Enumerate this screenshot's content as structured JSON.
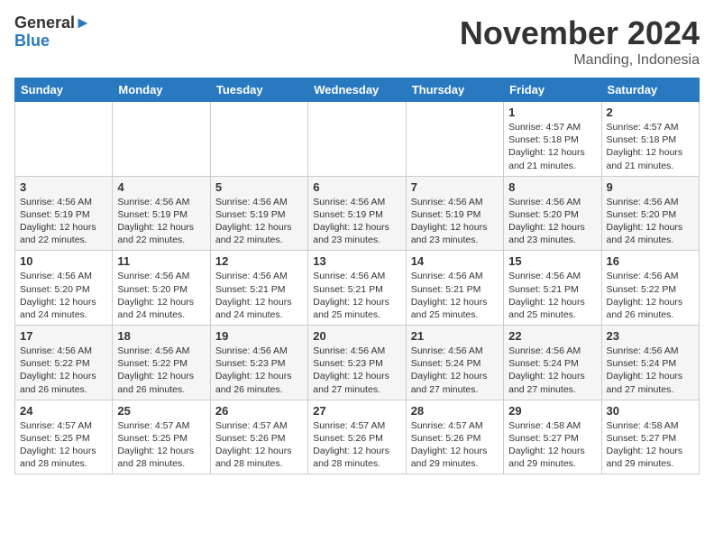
{
  "logo": {
    "general": "General",
    "blue": "Blue"
  },
  "title": "November 2024",
  "location": "Manding, Indonesia",
  "weekdays": [
    "Sunday",
    "Monday",
    "Tuesday",
    "Wednesday",
    "Thursday",
    "Friday",
    "Saturday"
  ],
  "weeks": [
    [
      null,
      null,
      null,
      null,
      null,
      {
        "day": "1",
        "sunrise": "Sunrise: 4:57 AM",
        "sunset": "Sunset: 5:18 PM",
        "daylight": "Daylight: 12 hours and 21 minutes."
      },
      {
        "day": "2",
        "sunrise": "Sunrise: 4:57 AM",
        "sunset": "Sunset: 5:18 PM",
        "daylight": "Daylight: 12 hours and 21 minutes."
      }
    ],
    [
      {
        "day": "3",
        "sunrise": "Sunrise: 4:56 AM",
        "sunset": "Sunset: 5:19 PM",
        "daylight": "Daylight: 12 hours and 22 minutes."
      },
      {
        "day": "4",
        "sunrise": "Sunrise: 4:56 AM",
        "sunset": "Sunset: 5:19 PM",
        "daylight": "Daylight: 12 hours and 22 minutes."
      },
      {
        "day": "5",
        "sunrise": "Sunrise: 4:56 AM",
        "sunset": "Sunset: 5:19 PM",
        "daylight": "Daylight: 12 hours and 22 minutes."
      },
      {
        "day": "6",
        "sunrise": "Sunrise: 4:56 AM",
        "sunset": "Sunset: 5:19 PM",
        "daylight": "Daylight: 12 hours and 23 minutes."
      },
      {
        "day": "7",
        "sunrise": "Sunrise: 4:56 AM",
        "sunset": "Sunset: 5:19 PM",
        "daylight": "Daylight: 12 hours and 23 minutes."
      },
      {
        "day": "8",
        "sunrise": "Sunrise: 4:56 AM",
        "sunset": "Sunset: 5:20 PM",
        "daylight": "Daylight: 12 hours and 23 minutes."
      },
      {
        "day": "9",
        "sunrise": "Sunrise: 4:56 AM",
        "sunset": "Sunset: 5:20 PM",
        "daylight": "Daylight: 12 hours and 24 minutes."
      }
    ],
    [
      {
        "day": "10",
        "sunrise": "Sunrise: 4:56 AM",
        "sunset": "Sunset: 5:20 PM",
        "daylight": "Daylight: 12 hours and 24 minutes."
      },
      {
        "day": "11",
        "sunrise": "Sunrise: 4:56 AM",
        "sunset": "Sunset: 5:20 PM",
        "daylight": "Daylight: 12 hours and 24 minutes."
      },
      {
        "day": "12",
        "sunrise": "Sunrise: 4:56 AM",
        "sunset": "Sunset: 5:21 PM",
        "daylight": "Daylight: 12 hours and 24 minutes."
      },
      {
        "day": "13",
        "sunrise": "Sunrise: 4:56 AM",
        "sunset": "Sunset: 5:21 PM",
        "daylight": "Daylight: 12 hours and 25 minutes."
      },
      {
        "day": "14",
        "sunrise": "Sunrise: 4:56 AM",
        "sunset": "Sunset: 5:21 PM",
        "daylight": "Daylight: 12 hours and 25 minutes."
      },
      {
        "day": "15",
        "sunrise": "Sunrise: 4:56 AM",
        "sunset": "Sunset: 5:21 PM",
        "daylight": "Daylight: 12 hours and 25 minutes."
      },
      {
        "day": "16",
        "sunrise": "Sunrise: 4:56 AM",
        "sunset": "Sunset: 5:22 PM",
        "daylight": "Daylight: 12 hours and 26 minutes."
      }
    ],
    [
      {
        "day": "17",
        "sunrise": "Sunrise: 4:56 AM",
        "sunset": "Sunset: 5:22 PM",
        "daylight": "Daylight: 12 hours and 26 minutes."
      },
      {
        "day": "18",
        "sunrise": "Sunrise: 4:56 AM",
        "sunset": "Sunset: 5:22 PM",
        "daylight": "Daylight: 12 hours and 26 minutes."
      },
      {
        "day": "19",
        "sunrise": "Sunrise: 4:56 AM",
        "sunset": "Sunset: 5:23 PM",
        "daylight": "Daylight: 12 hours and 26 minutes."
      },
      {
        "day": "20",
        "sunrise": "Sunrise: 4:56 AM",
        "sunset": "Sunset: 5:23 PM",
        "daylight": "Daylight: 12 hours and 27 minutes."
      },
      {
        "day": "21",
        "sunrise": "Sunrise: 4:56 AM",
        "sunset": "Sunset: 5:24 PM",
        "daylight": "Daylight: 12 hours and 27 minutes."
      },
      {
        "day": "22",
        "sunrise": "Sunrise: 4:56 AM",
        "sunset": "Sunset: 5:24 PM",
        "daylight": "Daylight: 12 hours and 27 minutes."
      },
      {
        "day": "23",
        "sunrise": "Sunrise: 4:56 AM",
        "sunset": "Sunset: 5:24 PM",
        "daylight": "Daylight: 12 hours and 27 minutes."
      }
    ],
    [
      {
        "day": "24",
        "sunrise": "Sunrise: 4:57 AM",
        "sunset": "Sunset: 5:25 PM",
        "daylight": "Daylight: 12 hours and 28 minutes."
      },
      {
        "day": "25",
        "sunrise": "Sunrise: 4:57 AM",
        "sunset": "Sunset: 5:25 PM",
        "daylight": "Daylight: 12 hours and 28 minutes."
      },
      {
        "day": "26",
        "sunrise": "Sunrise: 4:57 AM",
        "sunset": "Sunset: 5:26 PM",
        "daylight": "Daylight: 12 hours and 28 minutes."
      },
      {
        "day": "27",
        "sunrise": "Sunrise: 4:57 AM",
        "sunset": "Sunset: 5:26 PM",
        "daylight": "Daylight: 12 hours and 28 minutes."
      },
      {
        "day": "28",
        "sunrise": "Sunrise: 4:57 AM",
        "sunset": "Sunset: 5:26 PM",
        "daylight": "Daylight: 12 hours and 29 minutes."
      },
      {
        "day": "29",
        "sunrise": "Sunrise: 4:58 AM",
        "sunset": "Sunset: 5:27 PM",
        "daylight": "Daylight: 12 hours and 29 minutes."
      },
      {
        "day": "30",
        "sunrise": "Sunrise: 4:58 AM",
        "sunset": "Sunset: 5:27 PM",
        "daylight": "Daylight: 12 hours and 29 minutes."
      }
    ]
  ]
}
